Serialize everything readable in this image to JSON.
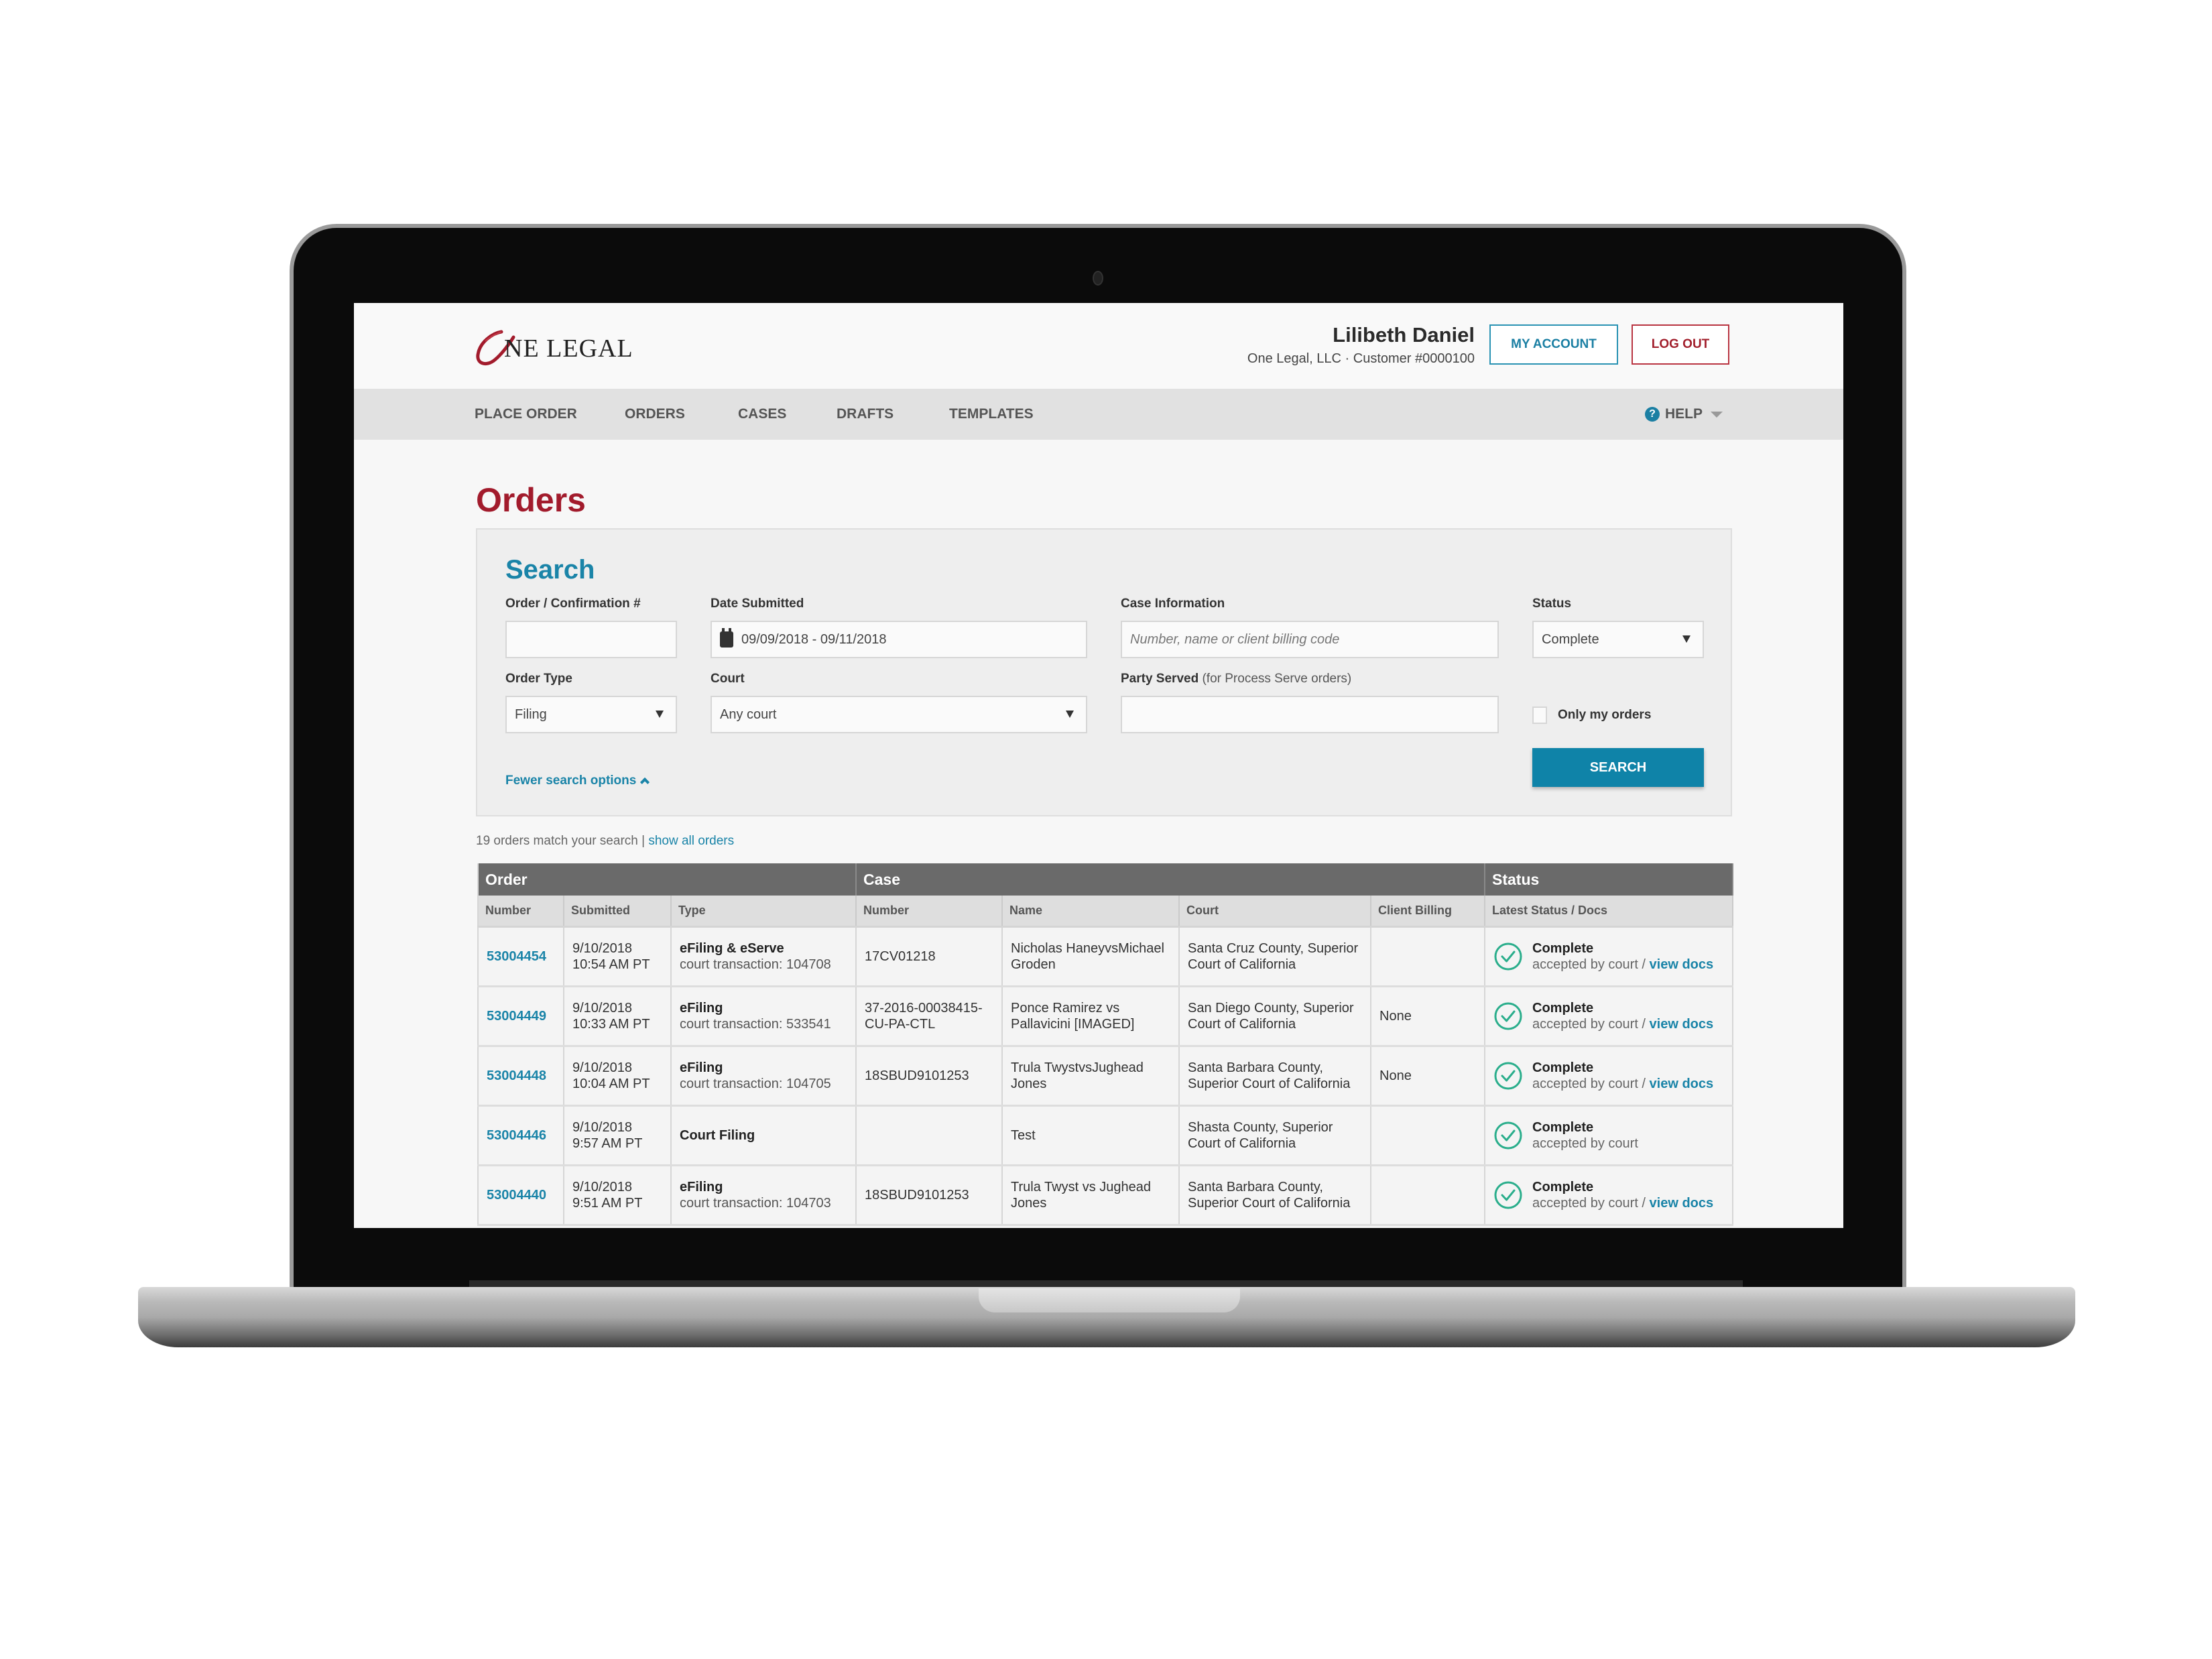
{
  "header": {
    "logo_initial": "O",
    "logo_text": "NE LEGAL",
    "user_name": "Lilibeth Daniel",
    "user_sub": "One Legal, LLC · Customer #0000100",
    "my_account_label": "MY ACCOUNT",
    "logout_label": "LOG OUT"
  },
  "nav": {
    "items": [
      {
        "label": "PLACE ORDER"
      },
      {
        "label": "ORDERS"
      },
      {
        "label": "CASES"
      },
      {
        "label": "DRAFTS"
      },
      {
        "label": "TEMPLATES"
      }
    ],
    "help_label": "HELP",
    "help_icon_glyph": "?"
  },
  "page_title": "Orders",
  "search": {
    "title": "Search",
    "order_confirmation": {
      "label": "Order / Confirmation #",
      "value": ""
    },
    "date_submitted": {
      "label": "Date Submitted",
      "value": "09/09/2018 - 09/11/2018"
    },
    "case_information": {
      "label": "Case Information",
      "placeholder": "Number, name or client billing code",
      "value": ""
    },
    "status": {
      "label": "Status",
      "value": "Complete"
    },
    "order_type": {
      "label": "Order Type",
      "value": "Filing"
    },
    "court": {
      "label": "Court",
      "value": "Any court"
    },
    "party_served": {
      "label": "Party Served",
      "label_note": "(for Process Serve orders)",
      "value": ""
    },
    "only_my_orders": {
      "label": "Only my orders",
      "checked": false
    },
    "fewer_options_label": "Fewer search options",
    "search_button_label": "SEARCH"
  },
  "results": {
    "count_text": "19 orders match your search |",
    "show_all_label": "show all orders"
  },
  "table": {
    "groups": [
      "Order",
      "Case",
      "Status"
    ],
    "columns": [
      "Number",
      "Submitted",
      "Type",
      "Number",
      "Name",
      "Court",
      "Client Billing",
      "Latest Status / Docs"
    ],
    "rows": [
      {
        "order_number": "53004454",
        "submitted_date": "9/10/2018",
        "submitted_time": "10:54 AM PT",
        "type": "eFiling & eServe",
        "type_sub": "court transaction: 104708",
        "case_number": "17CV01218",
        "case_name": "Nicholas HaneyvsMichael Groden",
        "court": "Santa Cruz County, Superior Court of California",
        "client_billing": "",
        "status": "Complete",
        "status_sub": "accepted by court",
        "docs_label": "view docs"
      },
      {
        "order_number": "53004449",
        "submitted_date": "9/10/2018",
        "submitted_time": "10:33 AM PT",
        "type": "eFiling",
        "type_sub": "court transaction: 533541",
        "case_number": "37-2016-00038415-CU-PA-CTL",
        "case_name": "Ponce Ramirez vs Pallavicini [IMAGED]",
        "court": "San Diego County, Superior Court of California",
        "client_billing": "None",
        "status": "Complete",
        "status_sub": "accepted by court",
        "docs_label": "view docs"
      },
      {
        "order_number": "53004448",
        "submitted_date": "9/10/2018",
        "submitted_time": "10:04 AM PT",
        "type": "eFiling",
        "type_sub": "court transaction: 104705",
        "case_number": "18SBUD9101253",
        "case_name": "Trula TwystvsJughead Jones",
        "court": "Santa Barbara County, Superior Court of California",
        "client_billing": "None",
        "status": "Complete",
        "status_sub": "accepted by court",
        "docs_label": "view docs"
      },
      {
        "order_number": "53004446",
        "submitted_date": "9/10/2018",
        "submitted_time": "9:57 AM PT",
        "type": "Court Filing",
        "type_sub": "",
        "case_number": "",
        "case_name": "Test",
        "court": "Shasta County, Superior Court of California",
        "client_billing": "",
        "status": "Complete",
        "status_sub": "accepted by court",
        "docs_label": ""
      },
      {
        "order_number": "53004440",
        "submitted_date": "9/10/2018",
        "submitted_time": "9:51 AM PT",
        "type": "eFiling",
        "type_sub": "court transaction: 104703",
        "case_number": "18SBUD9101253",
        "case_name": "Trula Twyst vs Jughead Jones",
        "court": "Santa Barbara County, Superior Court of California",
        "client_billing": "",
        "status": "Complete",
        "status_sub": "accepted by court",
        "docs_label": "view docs"
      }
    ]
  },
  "colors": {
    "brand_red": "#a21b2c",
    "accent_blue": "#1a84a8",
    "success_green": "#2bae8c"
  }
}
